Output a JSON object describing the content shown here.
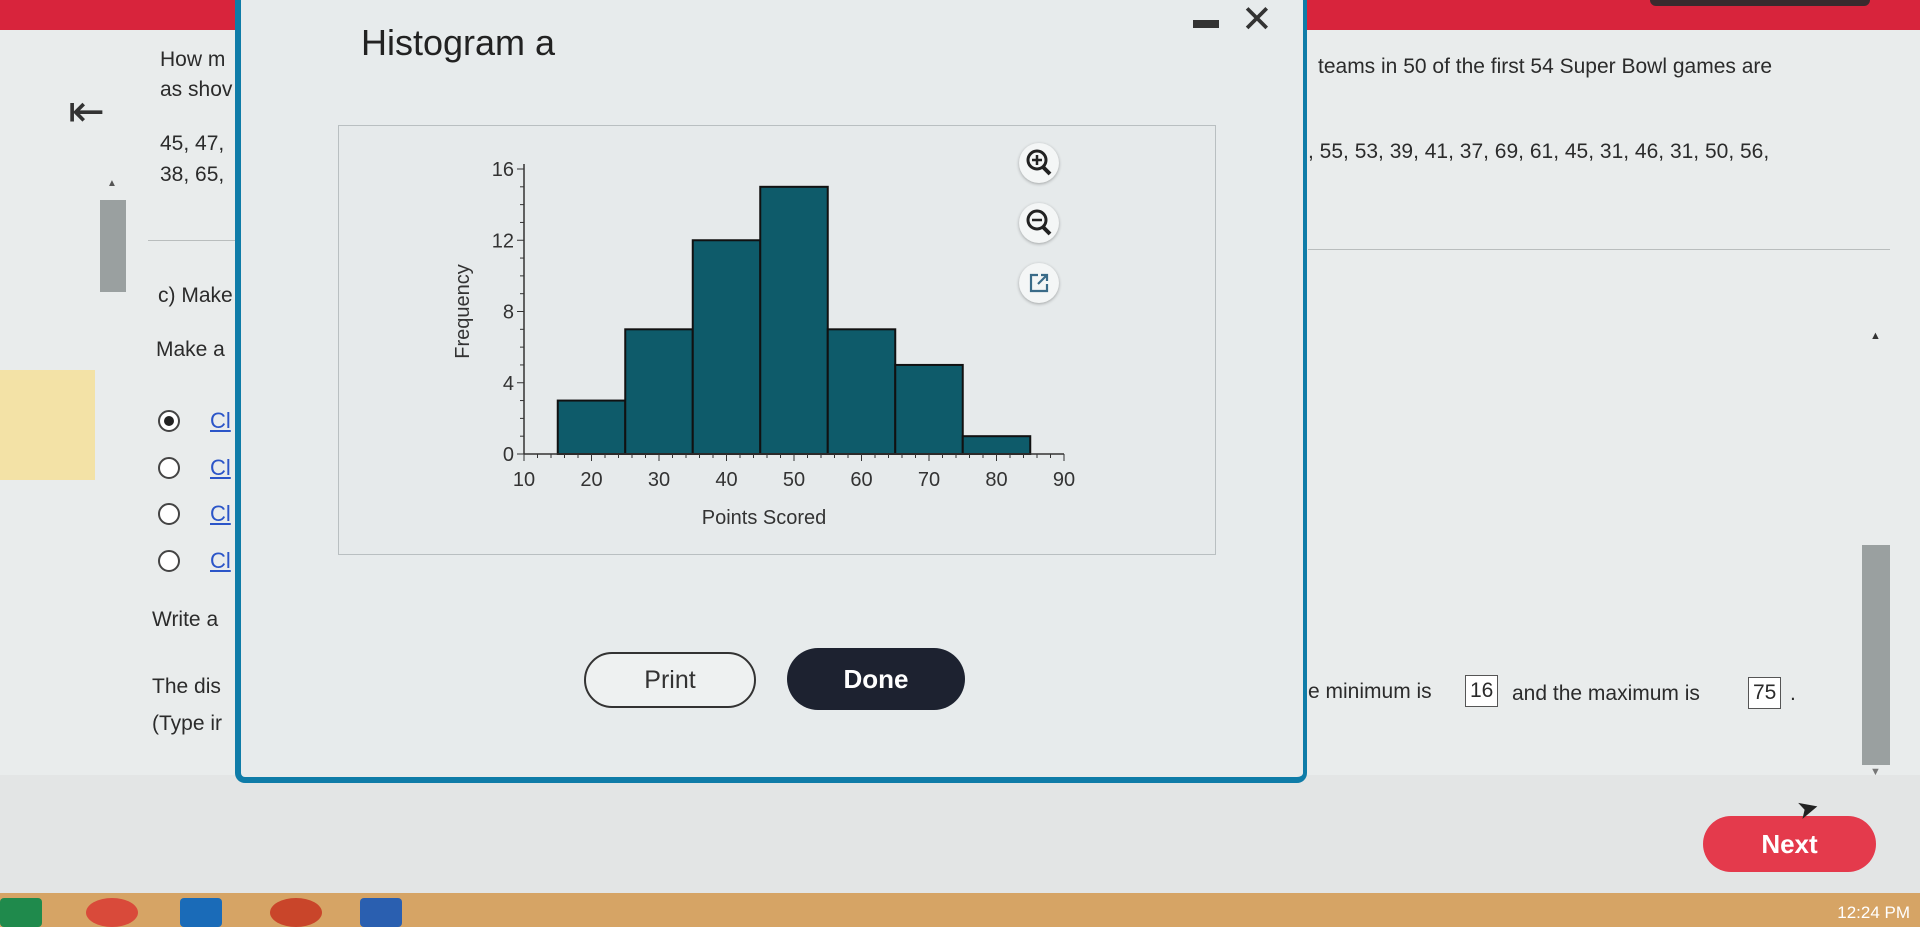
{
  "question": {
    "line1_left": "How m",
    "line1_right": "teams in 50 of the first 54 Super Bowl games are",
    "line2_left": "as shov",
    "data_left_1": "45, 47,",
    "data_left_2": "38, 65,",
    "data_right_1": ", 55, 53, 39, 41, 37, 69, 61, 45, 31, 46, 31, 50, 56,",
    "part_c": "c) Make",
    "make_a": "Make a",
    "options": [
      {
        "label": "Cl",
        "checked": true
      },
      {
        "label": "Cl",
        "checked": false
      },
      {
        "label": "Cl",
        "checked": false
      },
      {
        "label": "Cl",
        "checked": false
      }
    ],
    "write_a": "Write a",
    "dist_left": "The dis",
    "type_hint": "(Type ir",
    "min_text": "e minimum is",
    "min_value": "16",
    "and_max": "and the maximum is",
    "max_value": "75",
    "period": "."
  },
  "next_label": "Next",
  "clock": "12:24 PM",
  "modal": {
    "title": "Histogram a",
    "print_label": "Print",
    "done_label": "Done"
  },
  "chart_data": {
    "type": "bar",
    "xlabel": "Points Scored",
    "ylabel": "Frequency",
    "bin_edges": [
      15,
      25,
      35,
      45,
      55,
      65,
      75,
      85
    ],
    "values": [
      3,
      7,
      12,
      15,
      7,
      5,
      1
    ],
    "xlim": [
      10,
      90
    ],
    "ylim": [
      0,
      16
    ],
    "xticks": [
      10,
      20,
      30,
      40,
      50,
      60,
      70,
      80,
      90
    ],
    "yticks": [
      0,
      4,
      8,
      12,
      16
    ],
    "bar_color": "#0e5b6a",
    "grid": false
  }
}
